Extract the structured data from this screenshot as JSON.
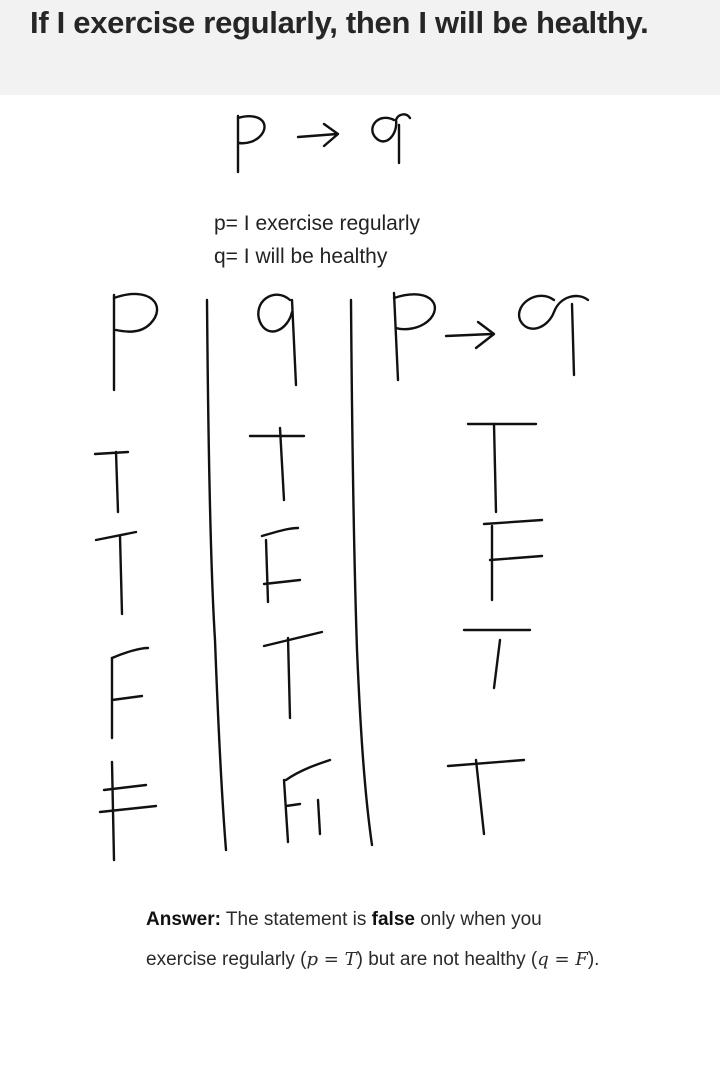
{
  "question": "If I exercise regularly, then I will be healthy.",
  "handwritten": {
    "formula": "p → q",
    "table": {
      "headers": [
        "p",
        "q",
        "p → q"
      ],
      "rows": [
        [
          "T",
          "T",
          "T"
        ],
        [
          "T",
          "F",
          "F"
        ],
        [
          "F",
          "T",
          "T"
        ],
        [
          "F",
          "F",
          "T"
        ]
      ]
    }
  },
  "definitions": {
    "p": "p= I exercise regularly",
    "q": "q= I will be healthy"
  },
  "answer": {
    "label": "Answer:",
    "text_1": " The statement is ",
    "bold_word": "false",
    "text_2": " only when you exercise regularly (",
    "cond_p_var": "p",
    "cond_p_val": "T",
    "text_3": ") but are not healthy (",
    "cond_q_var": "q",
    "cond_q_val": "F",
    "text_4": ")."
  }
}
